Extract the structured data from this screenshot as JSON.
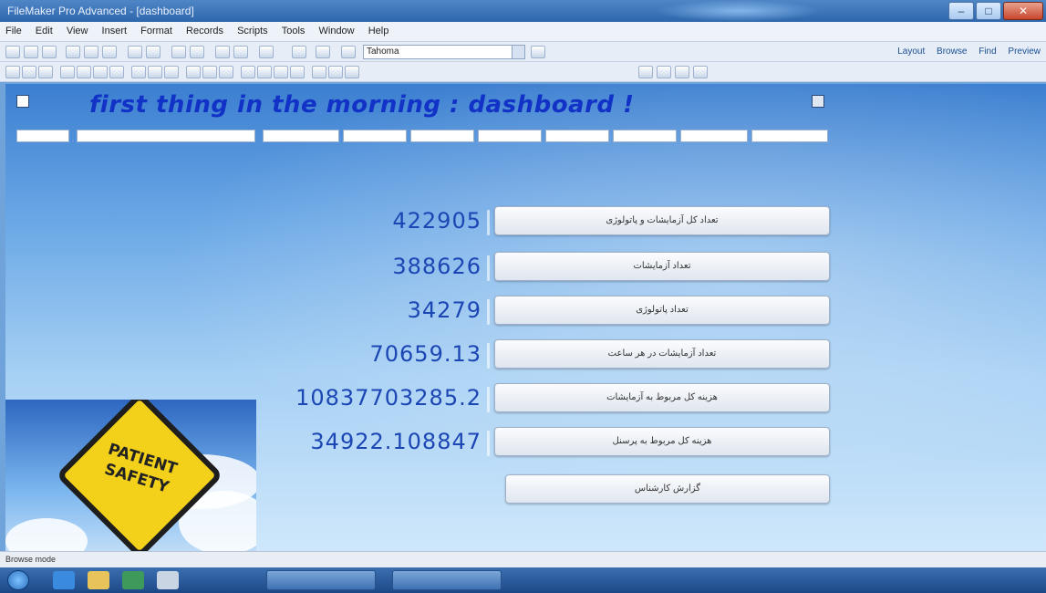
{
  "window": {
    "title": "FileMaker Pro Advanced - [dashboard]"
  },
  "menubar": {
    "items": [
      "File",
      "Edit",
      "View",
      "Insert",
      "Format",
      "Records",
      "Scripts",
      "Tools",
      "Window",
      "Help"
    ]
  },
  "toolbar": {
    "font_value": "Tahoma",
    "right_links": [
      "Layout",
      "Browse",
      "Find",
      "Preview"
    ]
  },
  "header": {
    "title": "first thing in the morning : dashboard !"
  },
  "filters": [
    "",
    "",
    "",
    "",
    "",
    "",
    "",
    "",
    "",
    ""
  ],
  "metrics": [
    {
      "value": "422905",
      "label": "تعداد کل آزمایشات و پاتولوژی"
    },
    {
      "value": "388626",
      "label": "تعداد آزمایشات"
    },
    {
      "value": "34279",
      "label": "تعداد پاتولوژی"
    },
    {
      "value": "70659.13",
      "label": "تعداد آزمایشات در هر ساعت"
    },
    {
      "value": "10837703285.2",
      "label": "هزینه کل مربوط به آزمایشات"
    },
    {
      "value": "34922.108847",
      "label": "هزینه کل مربوط به پرسنل"
    }
  ],
  "last_button": {
    "label": "گزارش کارشناس"
  },
  "sign": {
    "line1": "PATIENT",
    "line2": "SAFETY"
  },
  "statusbar": {
    "left": "Browse mode",
    "right": ""
  },
  "taskbar": {
    "tasks": [
      "",
      ""
    ],
    "clock": ""
  }
}
